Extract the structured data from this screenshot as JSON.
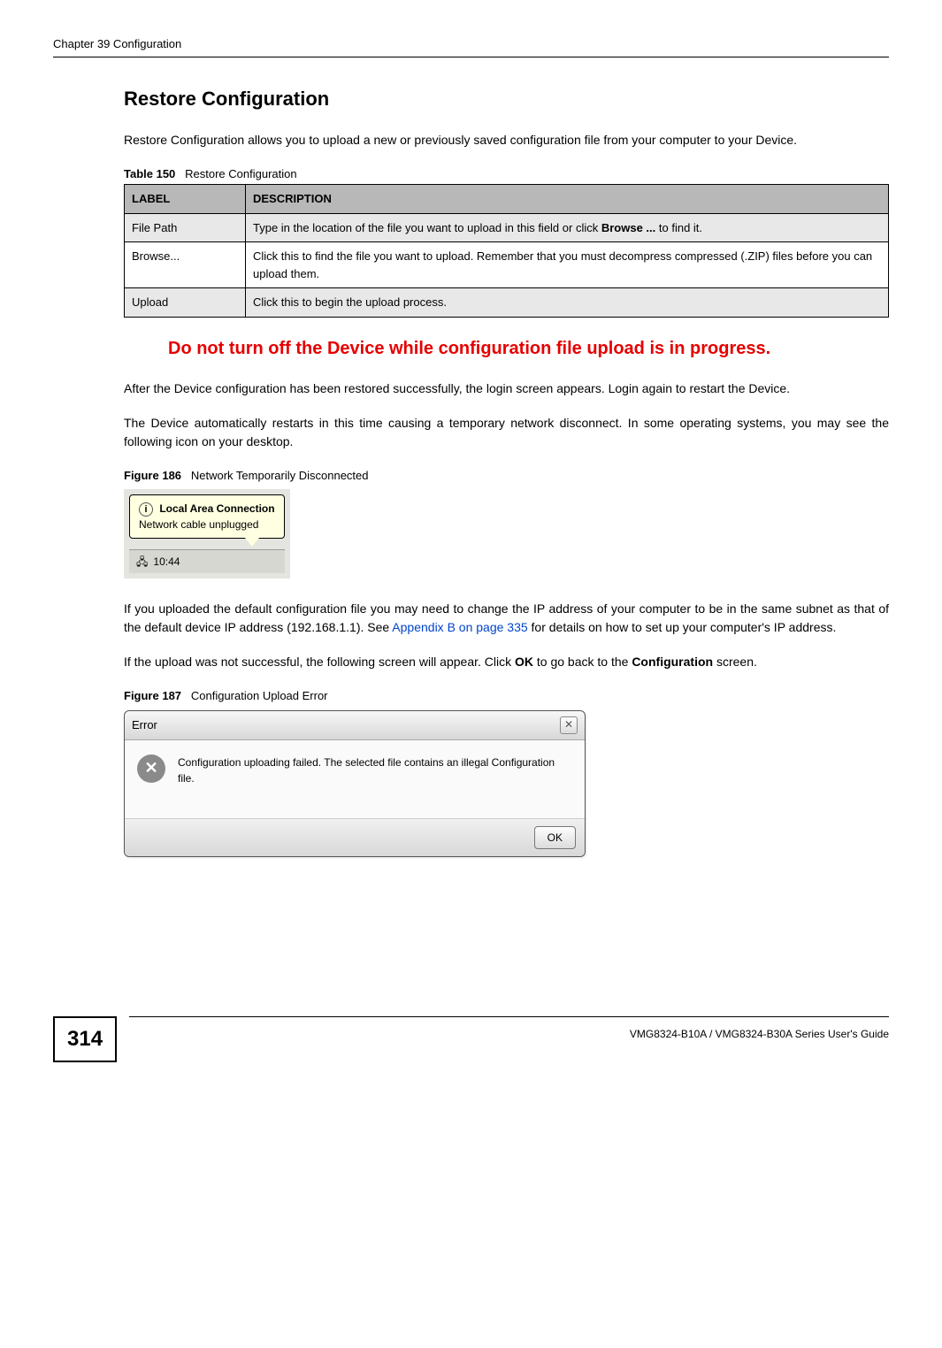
{
  "header": {
    "chapter": "Chapter 39 Configuration"
  },
  "section": {
    "heading": "Restore Configuration",
    "intro": "Restore Configuration allows you to upload a new or previously saved configuration file from your computer to your Device."
  },
  "table": {
    "caption_prefix": "Table 150",
    "caption_rest": "Restore Configuration",
    "headers": {
      "label": "LABEL",
      "description": "DESCRIPTION"
    },
    "rows": [
      {
        "label": "File Path",
        "description_before": "Type in the location of the file you want to upload in this field or click ",
        "description_bold": "Browse ...",
        "description_after": " to find it."
      },
      {
        "label": "Browse...",
        "description_before": "Click this to find the file you want to upload. Remember that you must decompress compressed (.ZIP) files before you can upload them.",
        "description_bold": "",
        "description_after": ""
      },
      {
        "label": "Upload",
        "description_before": "Click this to begin the upload process.",
        "description_bold": "",
        "description_after": ""
      }
    ]
  },
  "warning": "Do not turn off the Device while configuration file upload is in progress.",
  "para_after_warning": "After the Device configuration has been restored successfully, the login screen appears. Login again to restart the Device.",
  "para_disconnect": "The Device automatically restarts in this time causing a temporary network disconnect. In some operating systems, you may see the following icon on your desktop.",
  "figure186": {
    "caption_prefix": "Figure 186",
    "caption_rest": "Network Temporarily Disconnected",
    "balloon_title": "Local Area Connection",
    "balloon_text": "Network cable unplugged",
    "tray_time": "10:44"
  },
  "para_ip": {
    "before_link": "If you uploaded the default configuration file you may need to change the IP address of your computer to be in the same subnet as that of the default device IP address (192.168.1.1). See ",
    "link_text": "Appendix B on page 335",
    "after_link": " for details on how to set up your computer's IP address."
  },
  "para_upload_fail": {
    "before_bold1": "If the upload was not successful, the following screen will appear. Click ",
    "bold1": "OK",
    "between": " to go back to the ",
    "bold2": "Configuration",
    "after": " screen."
  },
  "figure187": {
    "caption_prefix": "Figure 187",
    "caption_rest": "Configuration Upload Error",
    "dialog_title": "Error",
    "dialog_body": "Configuration uploading failed. The selected file contains an illegal Configuration file.",
    "ok_label": "OK",
    "close_label": "✕"
  },
  "footer": {
    "page_number": "314",
    "guide": "VMG8324-B10A / VMG8324-B30A Series User's Guide"
  }
}
